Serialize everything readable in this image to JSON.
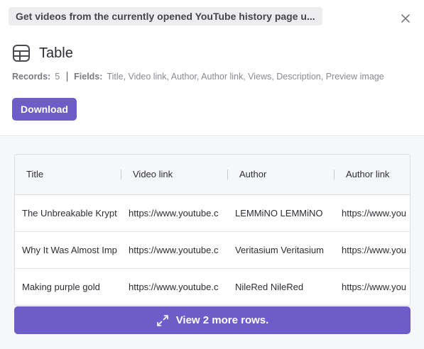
{
  "header": {
    "task_text": "Get videos from the currently opened YouTube history page u...",
    "close_icon": "close-icon",
    "title": "Table",
    "title_icon": "table-icon"
  },
  "meta": {
    "records_label": "Records:",
    "records_value": "5",
    "fields_label": "Fields:",
    "fields_value": "Title, Video link, Author, Author link, Views, Description, Preview image"
  },
  "actions": {
    "download_label": "Download",
    "more_rows_label": "View 2 more rows.",
    "more_rows_icon": "expand-icon"
  },
  "table": {
    "columns": [
      "Title",
      "Video link",
      "Author",
      "Author link"
    ],
    "rows": [
      [
        "The Unbreakable Krypt",
        "https://www.youtube.c",
        "LEMMiNO LEMMiNO",
        "https://www.you"
      ],
      [
        "Why It Was Almost Imp",
        "https://www.youtube.c",
        "Veritasium Veritasium",
        "https://www.you"
      ],
      [
        "Making purple gold",
        "https://www.youtube.c",
        "NileRed NileRed",
        "https://www.you"
      ]
    ]
  },
  "colors": {
    "accent": "#6e5cc9",
    "panel_bg": "#f6f7f9"
  }
}
